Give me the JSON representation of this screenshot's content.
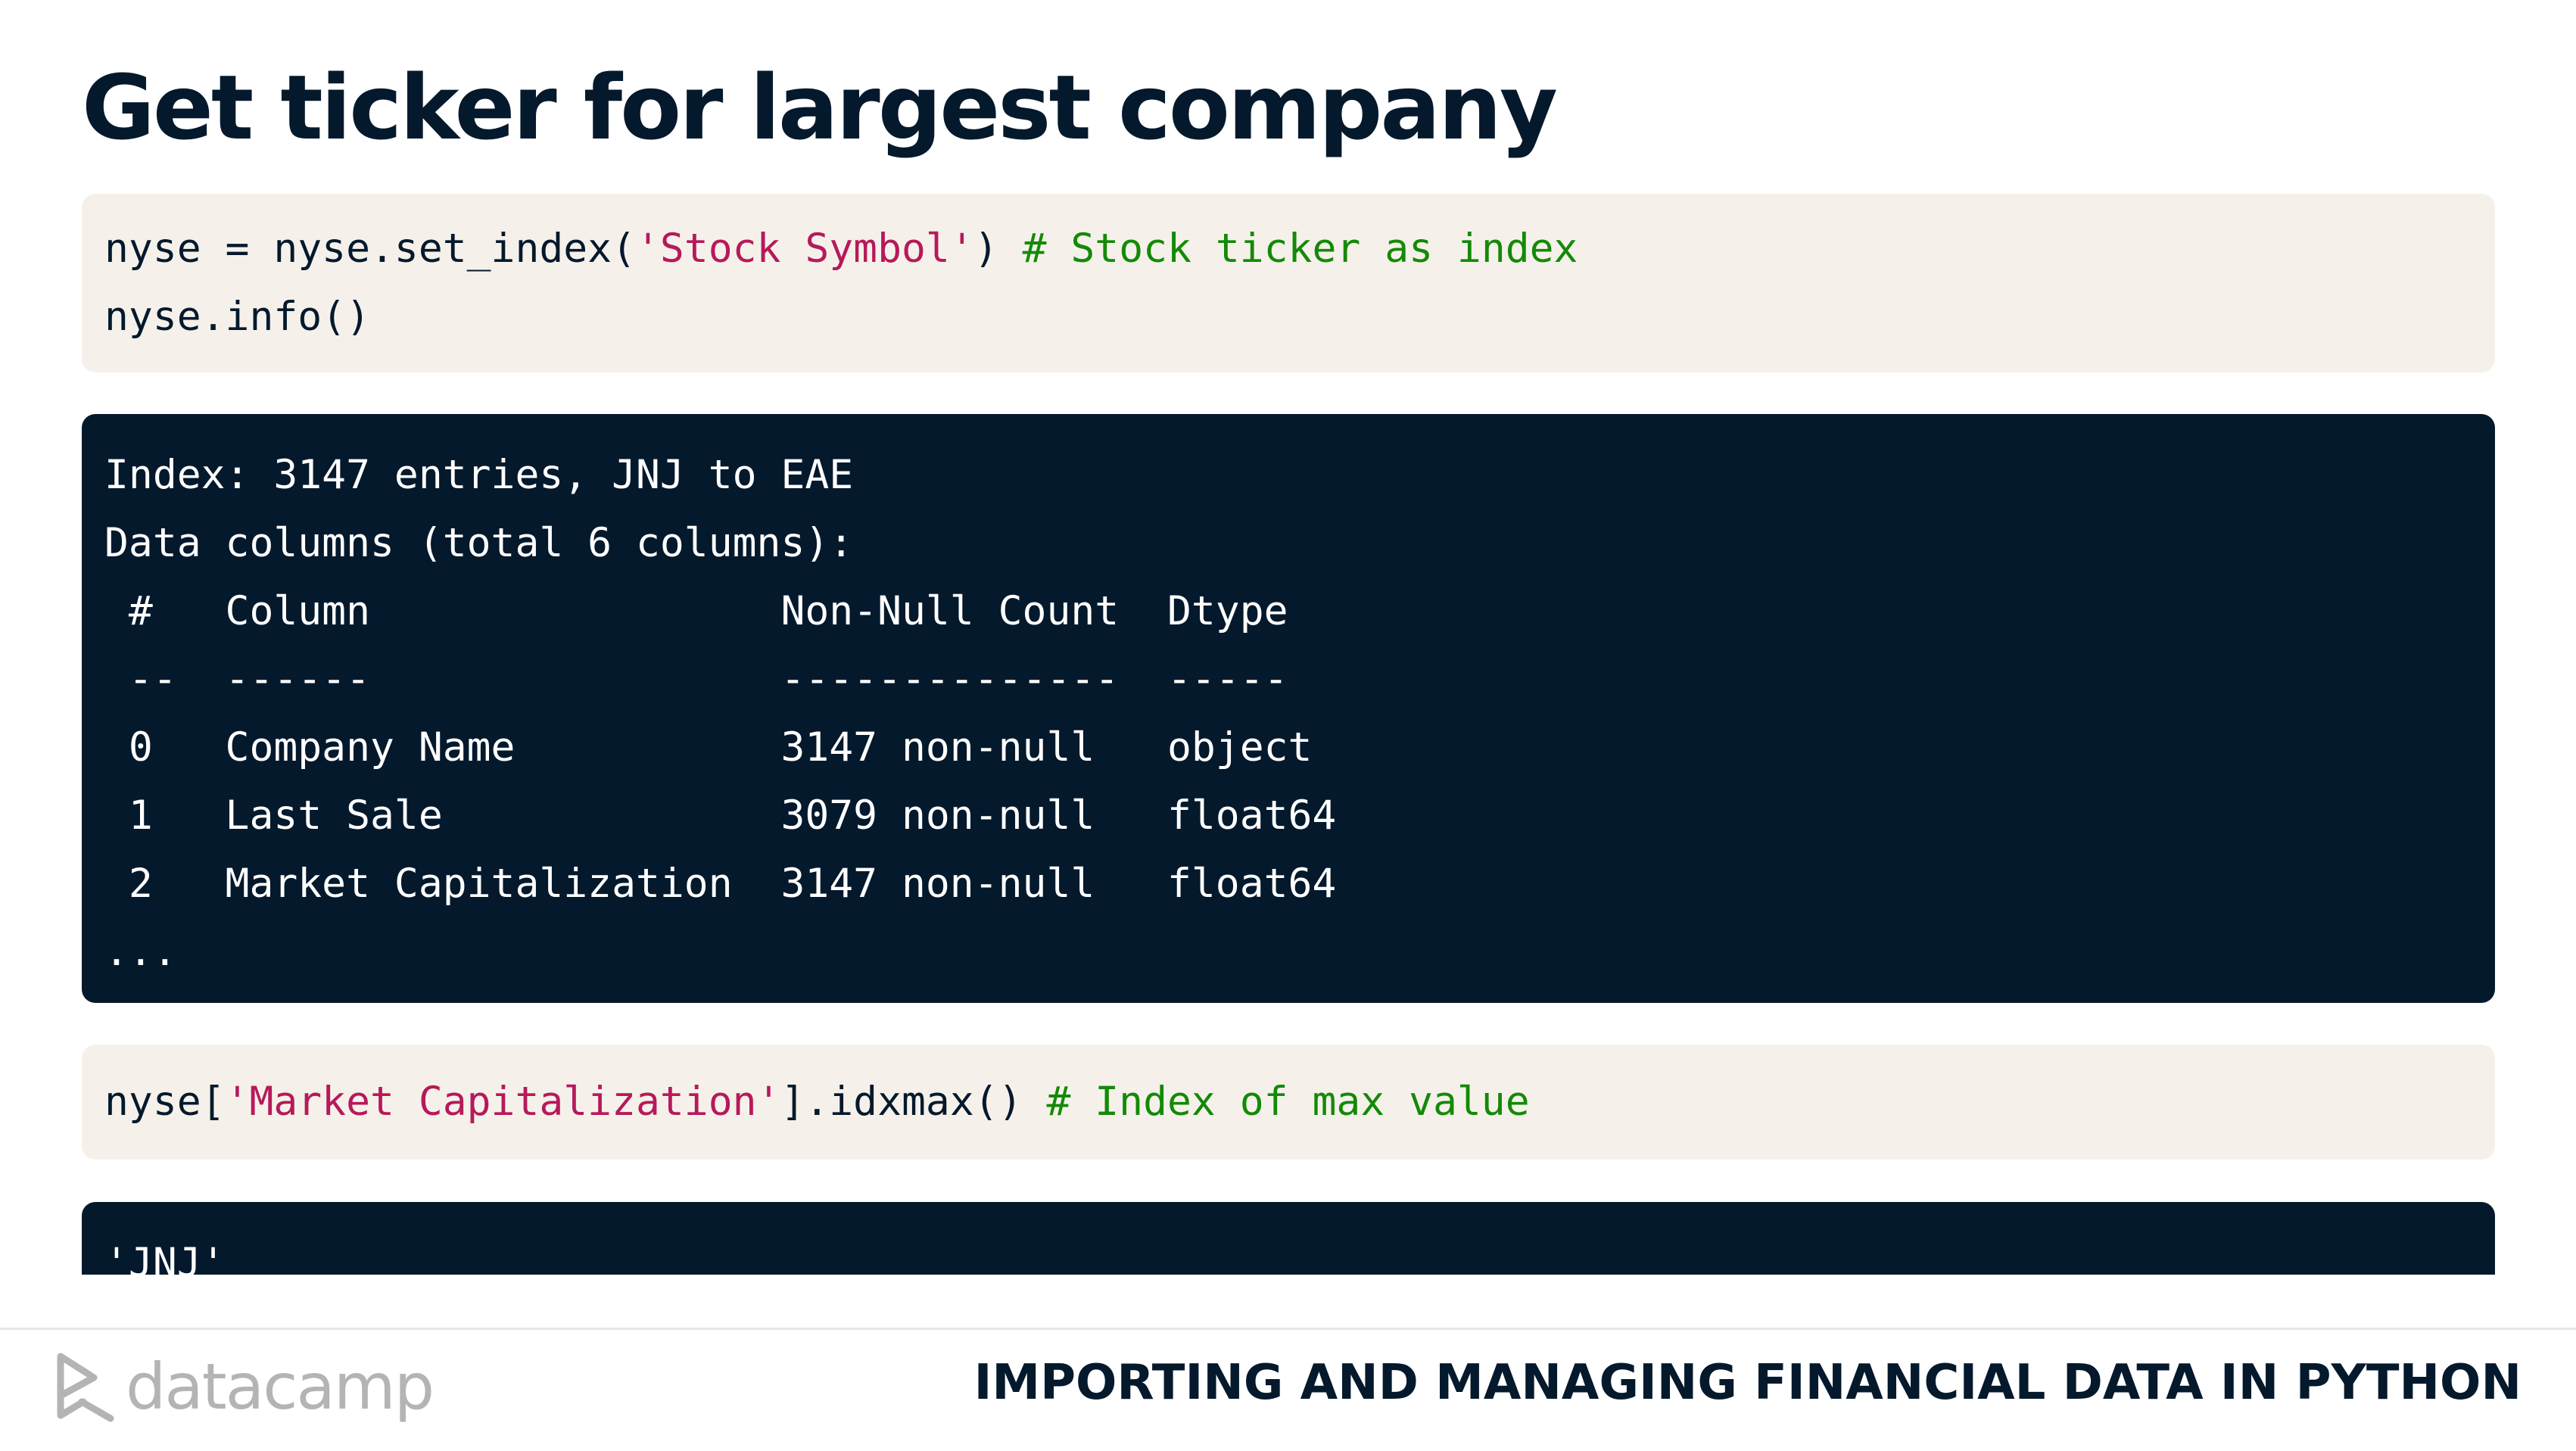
{
  "slide": {
    "title": "Get ticker for largest company"
  },
  "code_block_1": {
    "line1": {
      "pre": "nyse = nyse.set_index(",
      "string": "'Stock Symbol'",
      "post": ") ",
      "comment": "# Stock ticker as index"
    },
    "line2": "nyse.info()"
  },
  "output_block_1": {
    "lines": [
      "Index: 3147 entries, JNJ to EAE",
      "Data columns (total 6 columns):",
      " #   Column                 Non-Null Count  Dtype  ",
      " --  ------                 --------------  -----  ",
      " 0   Company Name           3147 non-null   object ",
      " 1   Last Sale              3079 non-null   float64",
      " 2   Market Capitalization  3147 non-null   float64",
      "..."
    ]
  },
  "code_block_2": {
    "pre": "nyse[",
    "string": "'Market Capitalization'",
    "post": "].idxmax() ",
    "comment": "# Index of max value"
  },
  "output_block_2": {
    "line": "'JNJ'"
  },
  "footer": {
    "brand": "datacamp",
    "course_title": "IMPORTING AND MANAGING FINANCIAL DATA IN PYTHON"
  },
  "colors": {
    "navy": "#05192d",
    "code_bg": "#f5f1ea",
    "string": "#b7195a",
    "comment": "#138a07",
    "logo_gray": "#b4b4b4"
  }
}
